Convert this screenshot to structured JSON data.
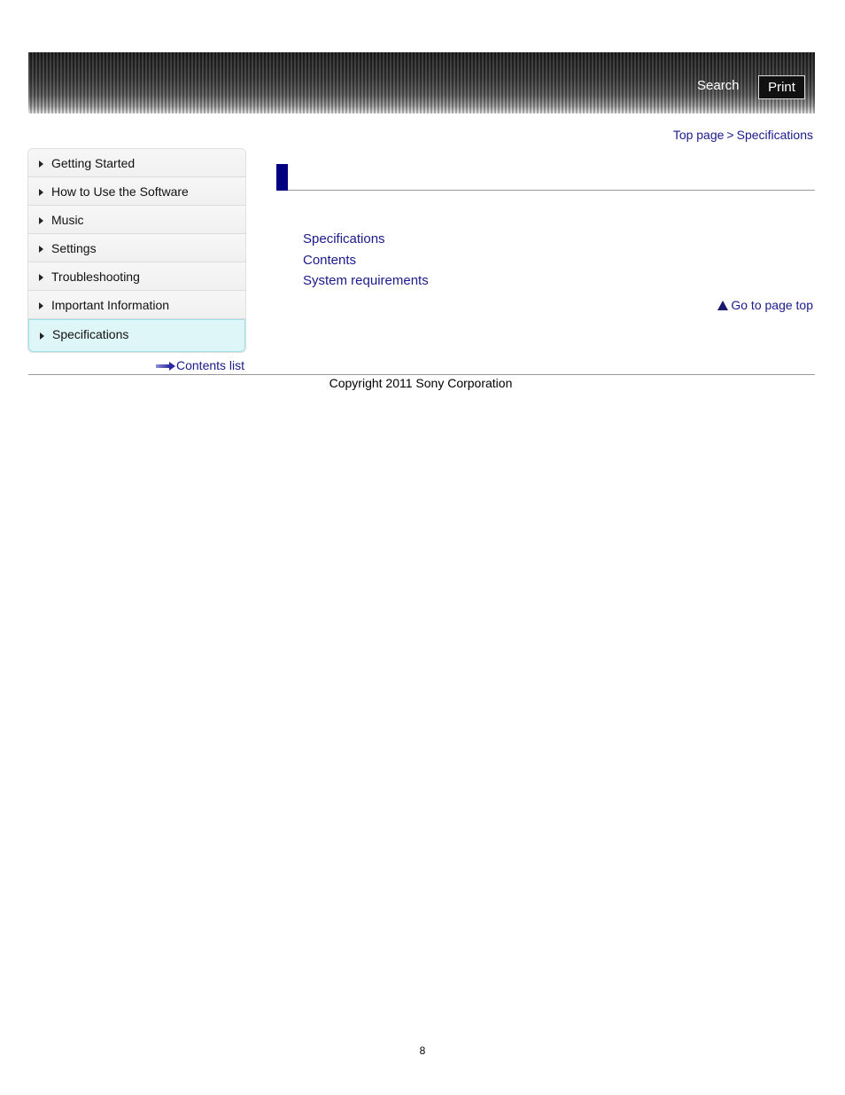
{
  "header": {
    "search_label": "Search",
    "print_label": "Print"
  },
  "breadcrumb": {
    "top_page": "Top page",
    "separator": ">",
    "current": "Specifications"
  },
  "sidebar": {
    "items": [
      {
        "label": "Getting Started"
      },
      {
        "label": "How to Use the Software"
      },
      {
        "label": "Music"
      },
      {
        "label": "Settings"
      },
      {
        "label": "Troubleshooting"
      },
      {
        "label": "Important Information"
      },
      {
        "label": "Specifications",
        "active": true
      }
    ],
    "contents_list": "Contents list"
  },
  "main": {
    "links": [
      {
        "label": "Specifications"
      },
      {
        "label": "Contents"
      },
      {
        "label": "System requirements"
      }
    ],
    "go_to_top": "Go to page top"
  },
  "footer": {
    "copyright": "Copyright 2011 Sony Corporation",
    "page_number": "8"
  },
  "colors": {
    "link": "#1a1a8c",
    "accent": "#000080",
    "active_nav_bg": "#dff6f8",
    "active_nav_border": "#9fe0ea"
  }
}
